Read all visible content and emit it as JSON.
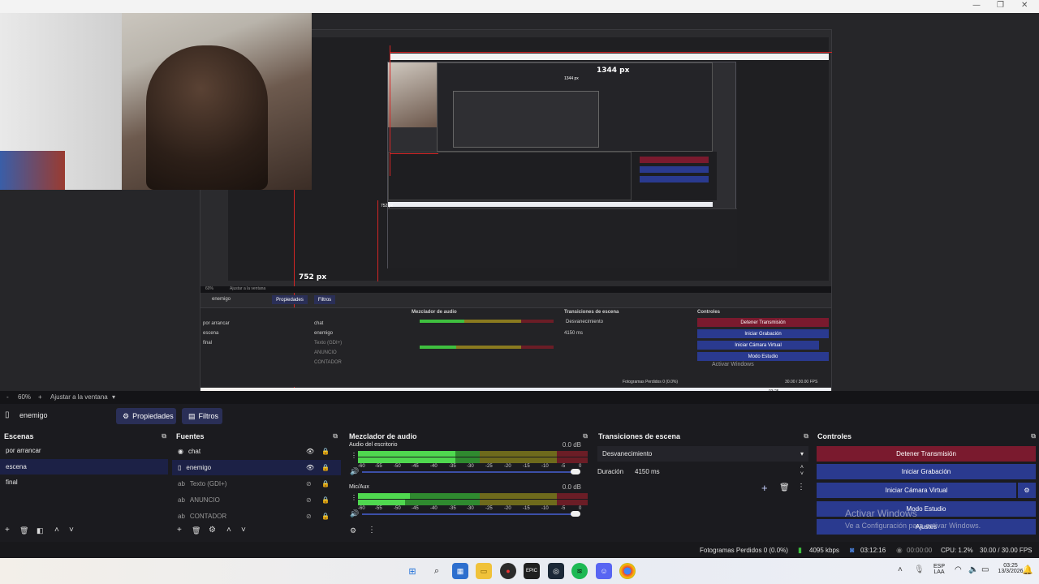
{
  "window": {
    "minimize_glyph": "—",
    "maximize_glyph": "❐",
    "close_glyph": "✕"
  },
  "preview": {
    "measure_width": "1344 px",
    "measure_height": "752 px",
    "nested_measure_width": "1344 px",
    "nested_measure_height": "752 px"
  },
  "zoom": {
    "minus": "-",
    "level": "60%",
    "plus": "+",
    "fit_label": "Ajustar a la ventana"
  },
  "toolbar": {
    "source_name": "enemigo",
    "properties_label": "Propiedades",
    "filters_label": "Filtros"
  },
  "scenes": {
    "title": "Escenas",
    "items": [
      {
        "label": "por arrancar"
      },
      {
        "label": "escena"
      },
      {
        "label": "final"
      }
    ]
  },
  "sources": {
    "title": "Fuentes",
    "items": [
      {
        "label": "chat",
        "icon": "browser-icon",
        "visible": true
      },
      {
        "label": "enemigo",
        "icon": "window-icon",
        "visible": true
      },
      {
        "label": "Texto (GDI+)",
        "icon": "text-icon",
        "visible": false
      },
      {
        "label": "ANUNCIO",
        "icon": "text-icon",
        "visible": false
      },
      {
        "label": "CONTADOR",
        "icon": "text-icon",
        "visible": false
      }
    ]
  },
  "mixer": {
    "title": "Mezclador de audio",
    "channels": [
      {
        "name": "Audio del escritorio",
        "db": "0.0 dB",
        "level_fraction": 0.44
      },
      {
        "name": "Mic/Aux",
        "db": "0.0 dB",
        "level_fraction": 0.23
      }
    ],
    "scale": [
      "-60",
      "-55",
      "-50",
      "-45",
      "-40",
      "-35",
      "-30",
      "-25",
      "-20",
      "-15",
      "-10",
      "-5",
      "0"
    ]
  },
  "transitions": {
    "title": "Transiciones de escena",
    "selected": "Desvanecimiento",
    "duration_label": "Duración",
    "duration_value": "4150 ms"
  },
  "controls": {
    "title": "Controles",
    "stop_stream": "Detener Transmisión",
    "start_recording": "Iniciar Grabación",
    "start_virtualcam": "Iniciar Cámara Virtual",
    "studio_mode": "Modo Estudio",
    "settings": "Ajustes",
    "watermark_title": "Activar Windows",
    "watermark_sub": "Ve a Configuración para activar Windows."
  },
  "status": {
    "dropped_frames": "Fotogramas Perdidos 0 (0.0%)",
    "bitrate": "4095 kbps",
    "stream_time": "03:12:16",
    "record_time": "00:00:00",
    "cpu": "CPU: 1.2%",
    "fps": "30.00 / 30.00 FPS"
  },
  "taskbar": {
    "apps": [
      "windows-start-icon",
      "search-icon",
      "store-icon",
      "file-explorer-icon",
      "app-icon",
      "epic-games-icon",
      "steam-icon",
      "spotify-icon",
      "discord-icon",
      "chrome-icon"
    ],
    "lang_top": "ESP",
    "lang_bottom": "LAA",
    "time": "03:25",
    "date": "13/3/2026"
  },
  "colors": {
    "accent_blue": "#2a3a8f",
    "stop_red": "#7a1a2e",
    "selection": "#1c2146",
    "meter_green": "#3fbf3f",
    "meter_yellow": "#8a7a1f",
    "meter_red": "#6b1d26"
  }
}
